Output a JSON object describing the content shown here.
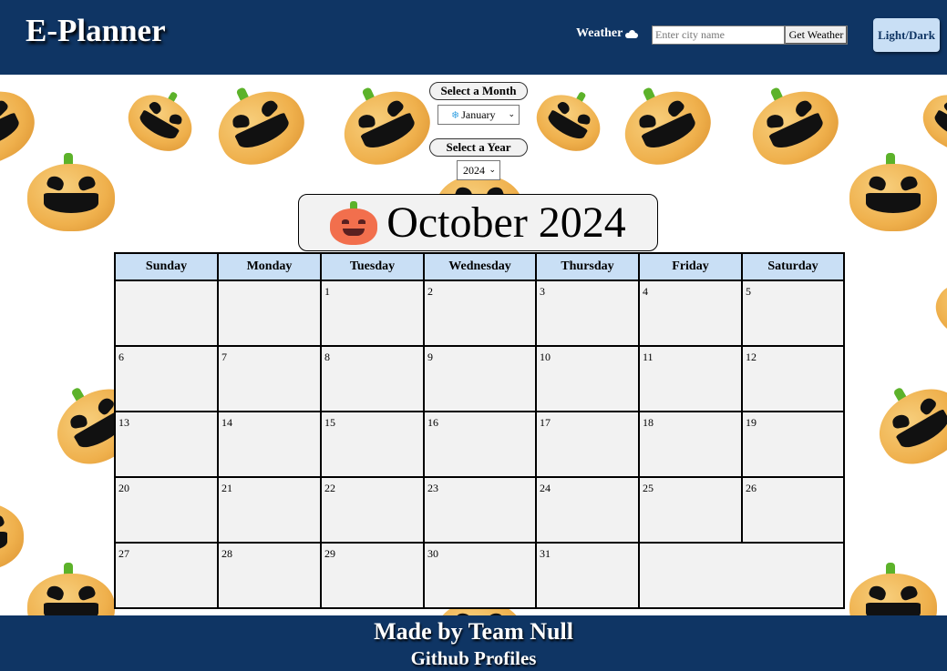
{
  "header": {
    "brand": "E-Planner",
    "weather_label": "Weather",
    "city_placeholder": "Enter city name",
    "get_weather_label": "Get Weather",
    "mode_toggle_label": "Light/Dark"
  },
  "selectors": {
    "month_label": "Select a Month",
    "month_value": "January",
    "year_label": "Select a Year",
    "year_value": "2024"
  },
  "calendar": {
    "title": "October 2024",
    "weekdays": [
      "Sunday",
      "Monday",
      "Tuesday",
      "Wednesday",
      "Thursday",
      "Friday",
      "Saturday"
    ],
    "weeks": [
      [
        "",
        "",
        "1",
        "2",
        "3",
        "4",
        "5"
      ],
      [
        "6",
        "7",
        "8",
        "9",
        "10",
        "11",
        "12"
      ],
      [
        "13",
        "14",
        "15",
        "16",
        "17",
        "18",
        "19"
      ],
      [
        "20",
        "21",
        "22",
        "23",
        "24",
        "25",
        "26"
      ],
      [
        "27",
        "28",
        "29",
        "30",
        "31"
      ]
    ]
  },
  "footer": {
    "title": "Made by Team Null",
    "subtitle": "Github Profiles"
  },
  "colors": {
    "header_bg": "#0f3564",
    "weekday_bg": "#c9dff5",
    "cell_bg": "#f2f2f2"
  }
}
